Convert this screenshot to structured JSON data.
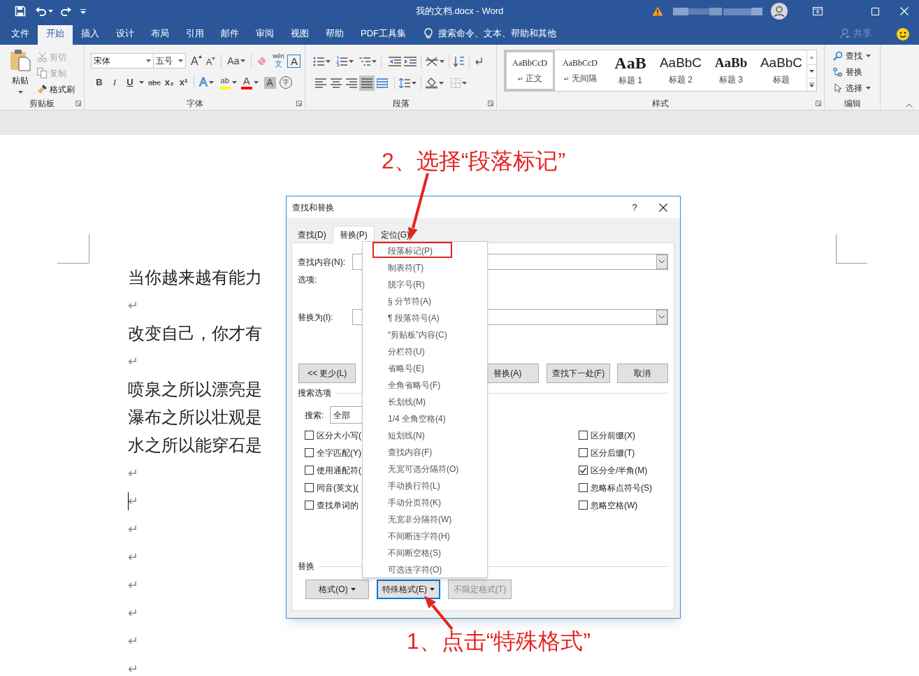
{
  "window": {
    "title": "我的文档.docx  -  Word"
  },
  "ribbon_tabs": [
    {
      "label": "文件",
      "selected": false
    },
    {
      "label": "开始",
      "selected": true
    },
    {
      "label": "插入",
      "selected": false
    },
    {
      "label": "设计",
      "selected": false
    },
    {
      "label": "布局",
      "selected": false
    },
    {
      "label": "引用",
      "selected": false
    },
    {
      "label": "邮件",
      "selected": false
    },
    {
      "label": "审阅",
      "selected": false
    },
    {
      "label": "视图",
      "selected": false
    },
    {
      "label": "帮助",
      "selected": false
    },
    {
      "label": "PDF工具集",
      "selected": false
    }
  ],
  "tell_me": "搜索命令、文本、帮助和其他",
  "share": "共享",
  "clipboard": {
    "paste": "粘贴",
    "commands": [
      {
        "label": "剪切",
        "kind": "cut",
        "disabled": true
      },
      {
        "label": "复制",
        "kind": "copy",
        "disabled": true
      },
      {
        "label": "格式刷",
        "kind": "painter",
        "disabled": false
      }
    ],
    "group_label": "剪贴板"
  },
  "font": {
    "font_name": "宋体",
    "font_size": "五号",
    "group_label": "字体",
    "row1": [
      {
        "kind": "grow",
        "label": "A"
      },
      {
        "kind": "shrink",
        "label": "A"
      },
      {
        "kind": "case",
        "label": "Aa"
      },
      {
        "kind": "clear"
      },
      {
        "kind": "phonetic",
        "label": "wén",
        "sub": "文"
      },
      {
        "kind": "border",
        "label": "A"
      }
    ],
    "row2": [
      {
        "kind": "bold",
        "label": "B"
      },
      {
        "kind": "italic",
        "label": "I"
      },
      {
        "kind": "underline",
        "label": "U"
      },
      {
        "kind": "strike",
        "label": "abc"
      },
      {
        "kind": "sub",
        "label": "x₂"
      },
      {
        "kind": "sup",
        "label": "x²"
      },
      {
        "kind": "effects",
        "label": "A"
      },
      {
        "kind": "highlight",
        "label": "ab",
        "color": "#ffff00"
      },
      {
        "kind": "color",
        "label": "A",
        "color": "#ff0000"
      },
      {
        "kind": "shading",
        "label": "A"
      },
      {
        "kind": "enclose",
        "label": "字"
      }
    ]
  },
  "paragraph": {
    "group_label": "段落",
    "alignments": [
      {
        "kind": "left",
        "selected": false
      },
      {
        "kind": "center",
        "selected": false
      },
      {
        "kind": "right",
        "selected": false
      },
      {
        "kind": "justify",
        "selected": true
      },
      {
        "kind": "distributed",
        "selected": false
      }
    ]
  },
  "styles": {
    "group_label": "样式",
    "items": [
      {
        "kind": "normal",
        "preview": "AaBbCcD",
        "name": "正文",
        "mark": "↵",
        "selected": true
      },
      {
        "kind": "normal",
        "preview": "AaBbCcD",
        "name": "无间隔",
        "mark": "↵",
        "selected": false
      },
      {
        "kind": "heading1",
        "preview": "AaB",
        "name": "标题 1",
        "selected": false
      },
      {
        "kind": "heading2",
        "preview": "AaBbC",
        "name": "标题 2",
        "selected": false
      },
      {
        "kind": "heading3",
        "preview": "AaBb",
        "name": "标题 3",
        "selected": false
      },
      {
        "kind": "heading2",
        "preview": "AaBbC",
        "name": "标题",
        "selected": false
      }
    ]
  },
  "editing": {
    "group_label": "编辑",
    "commands": [
      {
        "kind": "find",
        "label": "查找",
        "dropdown": true
      },
      {
        "kind": "replace",
        "label": "替换",
        "dropdown": false
      },
      {
        "kind": "select",
        "label": "选择",
        "dropdown": true
      }
    ]
  },
  "document": {
    "paragraphs": [
      {
        "kind": "text",
        "text": "当你越来越有能力"
      },
      {
        "kind": "mark",
        "text": "↵",
        "cursor": false
      },
      {
        "kind": "text",
        "text": "改变自己，你才有"
      },
      {
        "kind": "mark",
        "text": "↵",
        "cursor": false
      },
      {
        "kind": "text",
        "text": "喷泉之所以漂亮是"
      },
      {
        "kind": "text",
        "text": "瀑布之所以壮观是"
      },
      {
        "kind": "text",
        "text": "水之所以能穿石是"
      },
      {
        "kind": "mark",
        "text": "↵",
        "cursor": false
      },
      {
        "kind": "mark",
        "text": "↵",
        "cursor": true
      },
      {
        "kind": "mark",
        "text": "↵",
        "cursor": false
      },
      {
        "kind": "mark",
        "text": "↵",
        "cursor": false
      },
      {
        "kind": "mark",
        "text": "↵",
        "cursor": false
      },
      {
        "kind": "mark",
        "text": "↵",
        "cursor": false
      },
      {
        "kind": "mark",
        "text": "↵",
        "cursor": false
      },
      {
        "kind": "mark",
        "text": "↵",
        "cursor": false
      }
    ]
  },
  "dialog": {
    "title": "查找和替换",
    "help": "?",
    "tabs": [
      {
        "label": "查找(D)",
        "selected": false
      },
      {
        "label": "替换(P)",
        "selected": true
      },
      {
        "label": "定位(G)",
        "selected": false
      }
    ],
    "find_label": "查找内容(N):",
    "options_label": "选项:",
    "replace_label": "替换为(I):",
    "action_buttons": [
      {
        "label": "<< 更少(L)"
      },
      {
        "label": "替换(A)"
      },
      {
        "label": "查找下一处(F)"
      },
      {
        "label": "取消"
      }
    ],
    "search_options_heading": "搜索选项",
    "search_label": "搜索:",
    "search_value": "全部",
    "options_left": [
      {
        "label": "区分大小写(",
        "checked": false
      },
      {
        "label": "全字匹配(Y)",
        "checked": false
      },
      {
        "label": "使用通配符(",
        "checked": false
      },
      {
        "label": "同音(英文)(",
        "checked": false
      },
      {
        "label": "查找单词的",
        "checked": false
      }
    ],
    "options_right": [
      {
        "label": "区分前缀(X)",
        "checked": false
      },
      {
        "label": "区分后缀(T)",
        "checked": false
      },
      {
        "label": "区分全/半角(M)",
        "checked": true
      },
      {
        "label": "忽略标点符号(S)",
        "checked": false
      },
      {
        "label": "忽略空格(W)",
        "checked": false
      }
    ],
    "replace_heading": "替换",
    "format_buttons": [
      {
        "label": "格式(O)",
        "dropdown": true,
        "focused": false,
        "disabled": false
      },
      {
        "label": "特殊格式(E)",
        "dropdown": true,
        "focused": true,
        "disabled": false
      },
      {
        "label": "不限定格式(T)",
        "dropdown": false,
        "focused": false,
        "disabled": true
      }
    ]
  },
  "special_menu": {
    "items": [
      {
        "label": "段落标记(P)",
        "boxed": true
      },
      {
        "label": "制表符(T)",
        "boxed": false
      },
      {
        "label": "脱字号(R)",
        "boxed": false
      },
      {
        "label": "§ 分节符(A)",
        "boxed": false
      },
      {
        "label": "¶ 段落符号(A)",
        "boxed": false
      },
      {
        "label": "“剪贴板”内容(C)",
        "boxed": false
      },
      {
        "label": "分栏符(U)",
        "boxed": false
      },
      {
        "label": "省略号(E)",
        "boxed": false
      },
      {
        "label": "全角省略号(F)",
        "boxed": false
      },
      {
        "label": "长划线(M)",
        "boxed": false
      },
      {
        "label": "1/4  全角空格(4)",
        "boxed": false
      },
      {
        "label": "短划线(N)",
        "boxed": false
      },
      {
        "label": "查找内容(F)",
        "boxed": false
      },
      {
        "label": "无宽可选分隔符(O)",
        "boxed": false
      },
      {
        "label": "手动换行符(L)",
        "boxed": false
      },
      {
        "label": "手动分页符(K)",
        "boxed": false
      },
      {
        "label": "无宽非分隔符(W)",
        "boxed": false
      },
      {
        "label": "不间断连字符(H)",
        "boxed": false
      },
      {
        "label": "不间断空格(S)",
        "boxed": false
      },
      {
        "label": "可选连字符(O)",
        "boxed": false
      }
    ]
  },
  "annotations": [
    {
      "kind": "top",
      "text": "2、选择“段落标记”"
    },
    {
      "kind": "bottom",
      "text": "1、点击“特殊格式”"
    }
  ]
}
